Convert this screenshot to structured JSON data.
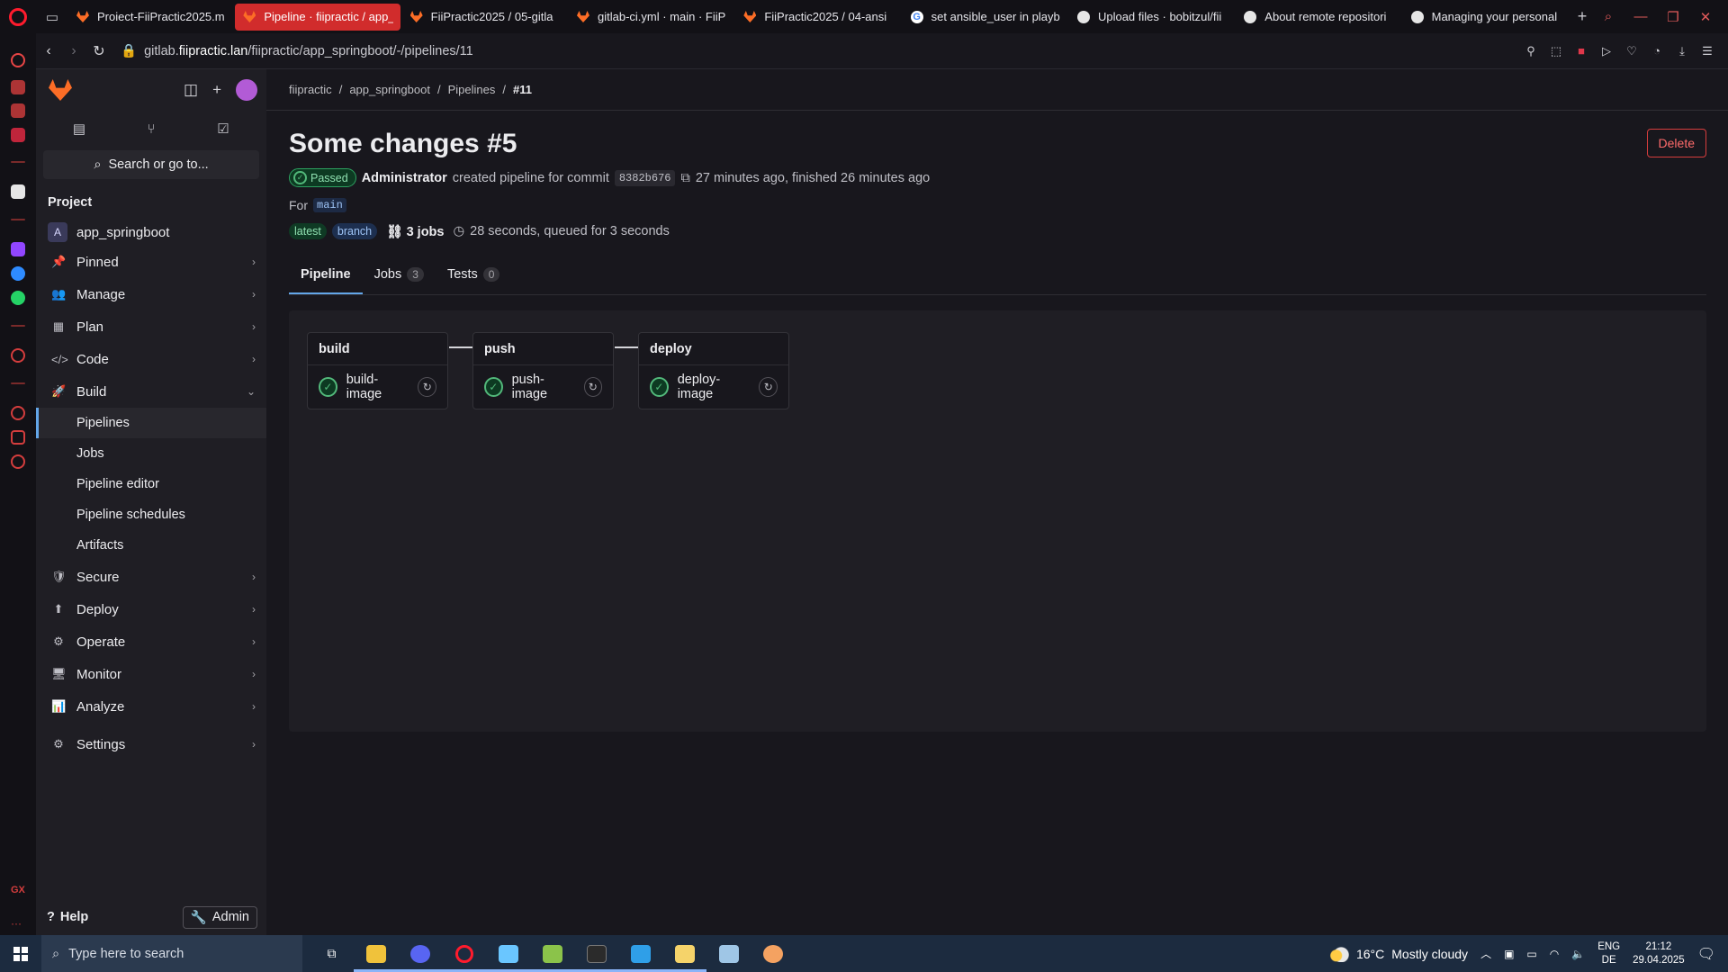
{
  "browser": {
    "tabs": [
      {
        "title": "Proiect-FiiPractic2025.m",
        "icon": "gitlab-fox-icon",
        "active": false
      },
      {
        "title": "Pipeline · fiipractic / app_",
        "icon": "gitlab-fox-icon",
        "active": true
      },
      {
        "title": "FiiPractic2025 / 05-gitla",
        "icon": "gitlab-fox-icon",
        "active": false
      },
      {
        "title": "gitlab-ci.yml · main · FiiP",
        "icon": "gitlab-fox-icon",
        "active": false
      },
      {
        "title": "FiiPractic2025 / 04-ansi",
        "icon": "gitlab-fox-icon",
        "active": false
      },
      {
        "title": "set ansible_user in playb",
        "icon": "google-icon",
        "active": false
      },
      {
        "title": "Upload files · bobitzul/fii",
        "icon": "github-icon",
        "active": false
      },
      {
        "title": "About remote repositori",
        "icon": "github-icon",
        "active": false
      },
      {
        "title": "Managing your personal",
        "icon": "github-icon",
        "active": false
      }
    ],
    "url_prefix": "gitlab.",
    "url_domain": "fiipractic.lan",
    "url_path": "/fiipractic/app_springboot/-/pipelines/11"
  },
  "sidebar": {
    "search_label": "Search or go to...",
    "section_title": "Project",
    "project_initial": "A",
    "project_name": "app_springboot",
    "items": [
      {
        "label": "Pinned",
        "icon": "pin-icon",
        "glyph": "📌"
      },
      {
        "label": "Manage",
        "icon": "users-icon",
        "glyph": "👥"
      },
      {
        "label": "Plan",
        "icon": "calendar-icon",
        "glyph": "▦"
      },
      {
        "label": "Code",
        "icon": "code-icon",
        "glyph": "</>"
      },
      {
        "label": "Build",
        "icon": "rocket-icon",
        "glyph": "🚀",
        "expanded": true
      }
    ],
    "build_subitems": [
      "Pipelines",
      "Jobs",
      "Pipeline editor",
      "Pipeline schedules",
      "Artifacts"
    ],
    "items_after": [
      {
        "label": "Secure",
        "icon": "shield-icon",
        "glyph": "🛡"
      },
      {
        "label": "Deploy",
        "icon": "deploy-icon",
        "glyph": "⬆"
      },
      {
        "label": "Operate",
        "icon": "cloud-gear-icon",
        "glyph": "⚙"
      },
      {
        "label": "Monitor",
        "icon": "monitor-icon",
        "glyph": "🖥"
      },
      {
        "label": "Analyze",
        "icon": "chart-icon",
        "glyph": "📊"
      }
    ],
    "settings_label": "Settings",
    "help_label": "Help",
    "admin_label": "Admin"
  },
  "breadcrumb": [
    "fiipractic",
    "app_springboot",
    "Pipelines",
    "#11"
  ],
  "pipeline": {
    "title": "Some changes #5",
    "delete_label": "Delete",
    "status": "Passed",
    "author": "Administrator",
    "created_text": "created pipeline for commit",
    "commit_sha": "8382b676",
    "timing_text": "27 minutes ago, finished 26 minutes ago",
    "for_label": "For",
    "ref": "main",
    "tag_latest": "latest",
    "tag_branch": "branch",
    "jobs_count_label": "3 jobs",
    "duration_text": "28 seconds, queued for 3 seconds"
  },
  "tabs": [
    {
      "label": "Pipeline",
      "count": null,
      "active": true
    },
    {
      "label": "Jobs",
      "count": "3",
      "active": false
    },
    {
      "label": "Tests",
      "count": "0",
      "active": false
    }
  ],
  "stages": [
    {
      "name": "build",
      "job": "build-image",
      "status": "success"
    },
    {
      "name": "push",
      "job": "push-image",
      "status": "success"
    },
    {
      "name": "deploy",
      "job": "deploy-image",
      "status": "success"
    }
  ],
  "taskbar": {
    "search_placeholder": "Type here to search",
    "weather_temp": "16°C",
    "weather_desc": "Mostly cloudy",
    "lang_top": "ENG",
    "lang_bottom": "DE",
    "time": "21:12",
    "date": "29.04.2025"
  },
  "colors": {
    "accent_red": "#d12c2c",
    "gitlab_orange": "#fc6d26",
    "success_green": "#52b87a",
    "link_blue": "#63a6e9"
  }
}
